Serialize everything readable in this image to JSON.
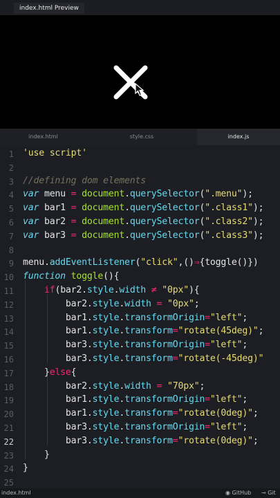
{
  "preview": {
    "tab_label": "index.html Preview"
  },
  "tabs": [
    {
      "label": "index.html",
      "active": false
    },
    {
      "label": "style.css",
      "active": false
    },
    {
      "label": "index.js",
      "active": true
    }
  ],
  "line_numbers": [
    "1",
    "2",
    "3",
    "4",
    "5",
    "6",
    "7",
    "8",
    "9",
    "10",
    "11",
    "12",
    "13",
    "14",
    "15",
    "16",
    "17",
    "18",
    "19",
    "20",
    "21",
    "22",
    "23",
    "24",
    "25"
  ],
  "code_lines": [
    [
      [
        "str",
        "'use script'"
      ]
    ],
    [],
    [
      [
        "cmt",
        "//defining dom elements"
      ]
    ],
    [
      [
        "key",
        "var"
      ],
      [
        "pl",
        " menu "
      ],
      [
        "op",
        "="
      ],
      [
        "pl",
        " "
      ],
      [
        "obj",
        "document"
      ],
      [
        "pl",
        "."
      ],
      [
        "fn",
        "querySelector"
      ],
      [
        "pl",
        "("
      ],
      [
        "str",
        "\".menu\""
      ],
      [
        "pl",
        ");"
      ]
    ],
    [
      [
        "key",
        "var"
      ],
      [
        "pl",
        " bar1 "
      ],
      [
        "op",
        "="
      ],
      [
        "pl",
        " "
      ],
      [
        "obj",
        "document"
      ],
      [
        "pl",
        "."
      ],
      [
        "fn",
        "querySelector"
      ],
      [
        "pl",
        "("
      ],
      [
        "str",
        "\".class1\""
      ],
      [
        "pl",
        ");"
      ]
    ],
    [
      [
        "key",
        "var"
      ],
      [
        "pl",
        " bar2 "
      ],
      [
        "op",
        "="
      ],
      [
        "pl",
        " "
      ],
      [
        "obj",
        "document"
      ],
      [
        "pl",
        "."
      ],
      [
        "fn",
        "querySelector"
      ],
      [
        "pl",
        "("
      ],
      [
        "str",
        "\".class2\""
      ],
      [
        "pl",
        ");"
      ]
    ],
    [
      [
        "key",
        "var"
      ],
      [
        "pl",
        " bar3 "
      ],
      [
        "op",
        "="
      ],
      [
        "pl",
        " "
      ],
      [
        "obj",
        "document"
      ],
      [
        "pl",
        "."
      ],
      [
        "fn",
        "querySelector"
      ],
      [
        "pl",
        "("
      ],
      [
        "str",
        "\".class3\""
      ],
      [
        "pl",
        ");"
      ]
    ],
    [],
    [
      [
        "pl",
        "menu."
      ],
      [
        "fn",
        "addEventListener"
      ],
      [
        "pl",
        "("
      ],
      [
        "str",
        "\"click\""
      ],
      [
        "pl",
        ",()"
      ],
      [
        "op",
        "⇒"
      ],
      [
        "pl",
        "{toggle()})"
      ]
    ],
    [
      [
        "key",
        "function"
      ],
      [
        "pl",
        " "
      ],
      [
        "obj",
        "toggle"
      ],
      [
        "pl",
        "(){"
      ]
    ],
    [
      [
        "pl",
        "    "
      ],
      [
        "op",
        "if"
      ],
      [
        "pl",
        "(bar2."
      ],
      [
        "prop",
        "style"
      ],
      [
        "pl",
        "."
      ],
      [
        "prop",
        "width"
      ],
      [
        "pl",
        " "
      ],
      [
        "op",
        "≠"
      ],
      [
        "pl",
        " "
      ],
      [
        "str",
        "\"0px\""
      ],
      [
        "pl",
        "){"
      ]
    ],
    [
      [
        "pl",
        "        bar2."
      ],
      [
        "prop",
        "style"
      ],
      [
        "pl",
        "."
      ],
      [
        "prop",
        "width"
      ],
      [
        "pl",
        " "
      ],
      [
        "op",
        "="
      ],
      [
        "pl",
        " "
      ],
      [
        "str",
        "\"0px\""
      ],
      [
        "pl",
        ";"
      ]
    ],
    [
      [
        "pl",
        "        bar1."
      ],
      [
        "prop",
        "style"
      ],
      [
        "pl",
        "."
      ],
      [
        "prop",
        "transformOrigin"
      ],
      [
        "op",
        "="
      ],
      [
        "str",
        "\"left\""
      ],
      [
        "pl",
        ";"
      ]
    ],
    [
      [
        "pl",
        "        bar1."
      ],
      [
        "prop",
        "style"
      ],
      [
        "pl",
        "."
      ],
      [
        "prop",
        "transform"
      ],
      [
        "op",
        "="
      ],
      [
        "str",
        "\"rotate(45deg)\""
      ],
      [
        "pl",
        ";"
      ]
    ],
    [
      [
        "pl",
        "        bar3."
      ],
      [
        "prop",
        "style"
      ],
      [
        "pl",
        "."
      ],
      [
        "prop",
        "transformOrigin"
      ],
      [
        "op",
        "="
      ],
      [
        "str",
        "\"left\""
      ],
      [
        "pl",
        ";"
      ]
    ],
    [
      [
        "pl",
        "        bar3."
      ],
      [
        "prop",
        "style"
      ],
      [
        "pl",
        "."
      ],
      [
        "prop",
        "transform"
      ],
      [
        "op",
        "="
      ],
      [
        "str",
        "\"rotate(-45deg)\""
      ]
    ],
    [
      [
        "pl",
        "    }"
      ],
      [
        "op",
        "else"
      ],
      [
        "pl",
        "{"
      ]
    ],
    [
      [
        "pl",
        "        bar2."
      ],
      [
        "prop",
        "style"
      ],
      [
        "pl",
        "."
      ],
      [
        "prop",
        "width"
      ],
      [
        "pl",
        " "
      ],
      [
        "op",
        "="
      ],
      [
        "pl",
        " "
      ],
      [
        "str",
        "\"70px\""
      ],
      [
        "pl",
        ";"
      ]
    ],
    [
      [
        "pl",
        "        bar1."
      ],
      [
        "prop",
        "style"
      ],
      [
        "pl",
        "."
      ],
      [
        "prop",
        "transformOrigin"
      ],
      [
        "op",
        "="
      ],
      [
        "str",
        "\"left\""
      ],
      [
        "pl",
        ";"
      ]
    ],
    [
      [
        "pl",
        "        bar1."
      ],
      [
        "prop",
        "style"
      ],
      [
        "pl",
        "."
      ],
      [
        "prop",
        "transform"
      ],
      [
        "op",
        "="
      ],
      [
        "str",
        "\"rotate(0deg)\""
      ],
      [
        "pl",
        ";"
      ]
    ],
    [
      [
        "pl",
        "        bar3."
      ],
      [
        "prop",
        "style"
      ],
      [
        "pl",
        "."
      ],
      [
        "prop",
        "transformOrigin"
      ],
      [
        "op",
        "="
      ],
      [
        "str",
        "\"left\""
      ],
      [
        "pl",
        ";"
      ]
    ],
    [
      [
        "pl",
        "        bar3."
      ],
      [
        "prop",
        "style"
      ],
      [
        "pl",
        "."
      ],
      [
        "prop",
        "transform"
      ],
      [
        "op",
        "="
      ],
      [
        "str",
        "\"rotate(0deg)\""
      ],
      [
        "pl",
        ";"
      ]
    ],
    [
      [
        "pl",
        "    }"
      ]
    ],
    [
      [
        "pl",
        "}"
      ]
    ],
    []
  ],
  "current_line": "22",
  "status": {
    "file": "index.html",
    "github": "GitHub",
    "git": "Git"
  },
  "colors": {
    "string": "#e6db74",
    "keyword": "#66d9ef",
    "comment": "#75715e",
    "object": "#a6e22e",
    "operator": "#f92672",
    "background": "#1c1e23"
  },
  "icons": [
    "close-icon",
    "cursor-icon",
    "github-icon",
    "git-icon"
  ]
}
